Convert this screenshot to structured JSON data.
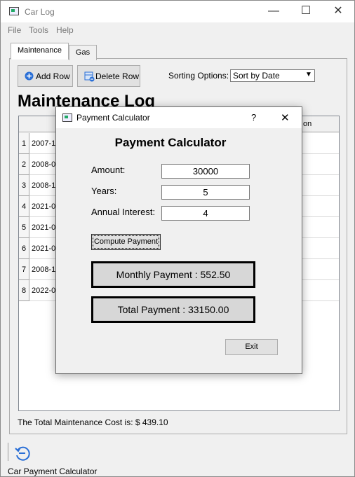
{
  "window": {
    "title": "Car Log"
  },
  "controls": {
    "minimize": "—",
    "maximize": "☐",
    "close": "✕"
  },
  "menu": [
    "File",
    "Tools",
    "Help"
  ],
  "tabs": [
    "Maintenance",
    "Gas"
  ],
  "toolbar": {
    "add_row": "Add Row",
    "delete_row": "Delete Row",
    "sorting_label": "Sorting Options:",
    "sort_value": "Sort by Date",
    "dropdown_arrow": "▼"
  },
  "log": {
    "heading": "Maintenance Log",
    "header_partial": "on",
    "rows": [
      {
        "num": "1",
        "date": "2007-1"
      },
      {
        "num": "2",
        "date": "2008-0"
      },
      {
        "num": "3",
        "date": "2008-1"
      },
      {
        "num": "4",
        "date": "2021-0"
      },
      {
        "num": "5",
        "date": "2021-0"
      },
      {
        "num": "6",
        "date": "2021-0"
      },
      {
        "num": "7",
        "date": "2008-1"
      },
      {
        "num": "8",
        "date": "2022-0"
      }
    ]
  },
  "total_cost": "The Total Maintenance Cost is: $  439.10",
  "status_bar": {
    "label": "Car Payment Calculator"
  },
  "dialog": {
    "title": "Payment Calculator",
    "help": "?",
    "close": "✕",
    "heading": "Payment Calculator",
    "amount_label": "Amount:",
    "amount_value": "30000",
    "years_label": "Years:",
    "years_value": "5",
    "interest_label": "Annual Interest:",
    "interest_value": "4",
    "compute_button": "Compute Payment",
    "monthly": "Monthly Payment : 552.50",
    "total": "Total Payment : 33150.00",
    "exit_button": "Exit"
  }
}
